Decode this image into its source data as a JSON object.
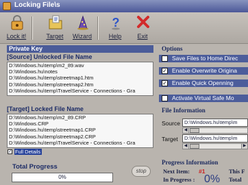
{
  "window": {
    "title": "Locking File\\s"
  },
  "toolbar": {
    "lock": "Lock it!",
    "target": "Target",
    "wizard": "Wizard",
    "help": "Help",
    "exit": "Exit"
  },
  "private_key": {
    "header": "Private Key",
    "source_title": "[Source] Unlocked File Name",
    "source_files": [
      "D:\\Windows.hu\\temp\\m2_89.wav",
      "D:\\Windows.hu\\notes",
      "D:\\Windows.hu\\temp\\streetmap1.htm",
      "D:\\Windows.hu\\temp\\streetmap2.htm",
      "D:\\Windows.hu\\temp\\TravelService - Connections - Gra"
    ],
    "target_title": "[Target] Locked File Name",
    "target_files": [
      "D:\\Windows.hu\\temp\\m2_89.CRP",
      "D:\\Windows.CRP",
      "D:\\Windows.hu\\temp\\streetmap1.CRP",
      "D:\\Windows.hu\\temp\\streetmap2.CRP",
      "D:\\Windows.hu\\temp\\TravelService - Connections - Gra"
    ],
    "full_details": "Full Details",
    "total_progress": "Total Progress",
    "progress_value": "0%",
    "progress_fraction": 0,
    "stop": "stop"
  },
  "options": {
    "title": "Options",
    "items": [
      {
        "label": "Save Files to Home Direc",
        "checked": false
      },
      {
        "label": "Enable Overwrite Origina",
        "checked": true
      },
      {
        "label": "Enable Quick Openning",
        "checked": true
      },
      {
        "label": "Activate Virtual Safe Mo",
        "checked": false
      }
    ]
  },
  "file_info": {
    "title": "File Information",
    "source_label": "Source",
    "source_value": "D:\\Windows.hu\\temp\\m",
    "target_label": "Target",
    "target_value": "D:\\Windows.hu\\temp\\m"
  },
  "progress_info": {
    "title": "Progress Information",
    "next_item_label": "Next Item:",
    "next_item_value": "#1",
    "this_label": "This F",
    "in_progress_label": "In Progress :",
    "in_progress_value": "0%",
    "total_label": "Total"
  }
}
